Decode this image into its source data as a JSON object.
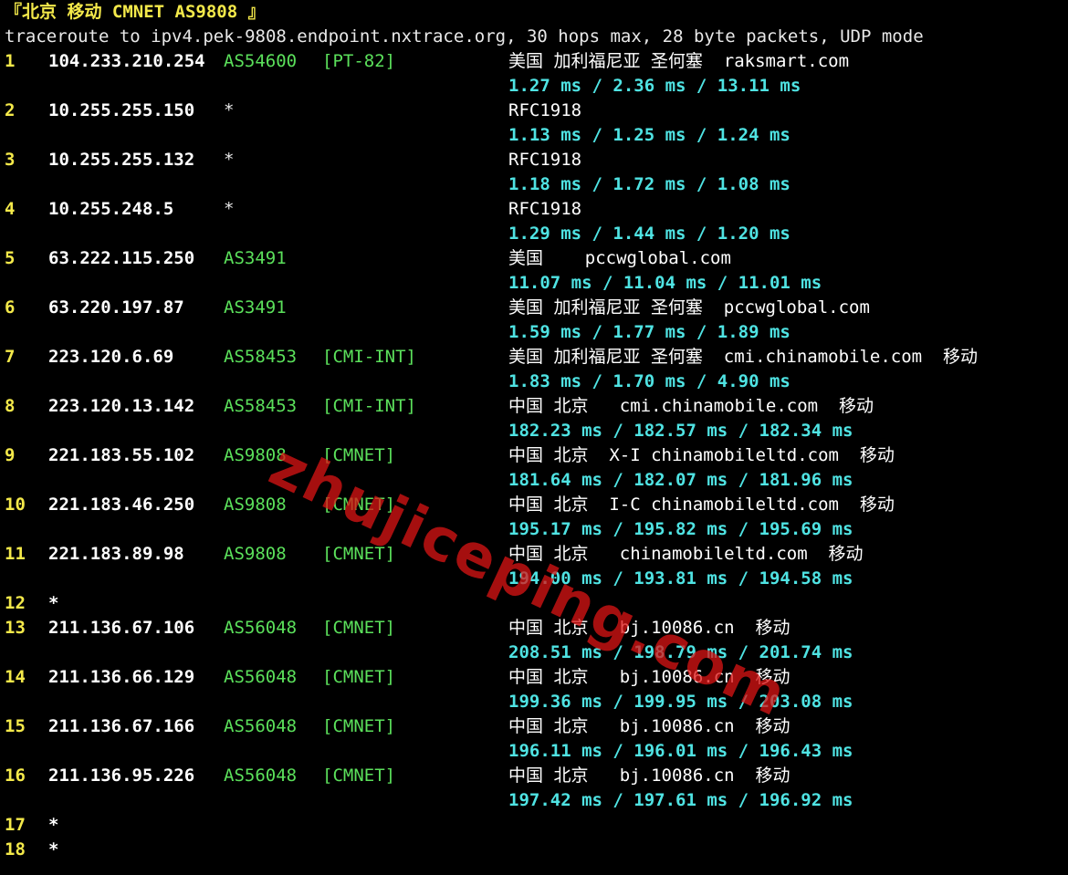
{
  "header": "『北京 移动 CMNET AS9808 』",
  "command": "traceroute to ipv4.pek-9808.endpoint.nxtrace.org, 30 hops max, 28 byte packets, UDP mode",
  "watermark": "zhujiceping.com",
  "hops": [
    {
      "hop": "1",
      "ip": "104.233.210.254",
      "asn": "AS54600",
      "tag": "[PT-82]",
      "geo": "美国 加利福尼亚 圣何塞  raksmart.com",
      "rtt": "1.27 ms / 2.36 ms / 13.11 ms"
    },
    {
      "hop": "2",
      "ip": "10.255.255.150",
      "asn": "*",
      "tag": "",
      "geo": "RFC1918",
      "rtt": "1.13 ms / 1.25 ms / 1.24 ms"
    },
    {
      "hop": "3",
      "ip": "10.255.255.132",
      "asn": "*",
      "tag": "",
      "geo": "RFC1918",
      "rtt": "1.18 ms / 1.72 ms / 1.08 ms"
    },
    {
      "hop": "4",
      "ip": "10.255.248.5",
      "asn": "*",
      "tag": "",
      "geo": "RFC1918",
      "rtt": "1.29 ms / 1.44 ms / 1.20 ms"
    },
    {
      "hop": "5",
      "ip": "63.222.115.250",
      "asn": "AS3491",
      "tag": "",
      "geo": "美国    pccwglobal.com",
      "rtt": "11.07 ms / 11.04 ms / 11.01 ms"
    },
    {
      "hop": "6",
      "ip": "63.220.197.87",
      "asn": "AS3491",
      "tag": "",
      "geo": "美国 加利福尼亚 圣何塞  pccwglobal.com",
      "rtt": "1.59 ms / 1.77 ms / 1.89 ms"
    },
    {
      "hop": "7",
      "ip": "223.120.6.69",
      "asn": "AS58453",
      "tag": "[CMI-INT]",
      "geo": "美国 加利福尼亚 圣何塞  cmi.chinamobile.com  移动",
      "rtt": "1.83 ms / 1.70 ms / 4.90 ms"
    },
    {
      "hop": "8",
      "ip": "223.120.13.142",
      "asn": "AS58453",
      "tag": "[CMI-INT]",
      "geo": "中国 北京   cmi.chinamobile.com  移动",
      "rtt": "182.23 ms / 182.57 ms / 182.34 ms"
    },
    {
      "hop": "9",
      "ip": "221.183.55.102",
      "asn": "AS9808",
      "tag": "[CMNET]",
      "geo": "中国 北京  X-I chinamobileltd.com  移动",
      "rtt": "181.64 ms / 182.07 ms / 181.96 ms"
    },
    {
      "hop": "10",
      "ip": "221.183.46.250",
      "asn": "AS9808",
      "tag": "[CMNET]",
      "geo": "中国 北京  I-C chinamobileltd.com  移动",
      "rtt": "195.17 ms / 195.82 ms / 195.69 ms"
    },
    {
      "hop": "11",
      "ip": "221.183.89.98",
      "asn": "AS9808",
      "tag": "[CMNET]",
      "geo": "中国 北京   chinamobileltd.com  移动",
      "rtt": "194.00 ms / 193.81 ms / 194.58 ms"
    },
    {
      "hop": "12",
      "ip": "*",
      "asn": "",
      "tag": "",
      "geo": "",
      "rtt": ""
    },
    {
      "hop": "13",
      "ip": "211.136.67.106",
      "asn": "AS56048",
      "tag": "[CMNET]",
      "geo": "中国 北京   bj.10086.cn  移动",
      "rtt": "208.51 ms / 198.79 ms / 201.74 ms"
    },
    {
      "hop": "14",
      "ip": "211.136.66.129",
      "asn": "AS56048",
      "tag": "[CMNET]",
      "geo": "中国 北京   bj.10086.cn  移动",
      "rtt": "199.36 ms / 199.95 ms / 203.08 ms"
    },
    {
      "hop": "15",
      "ip": "211.136.67.166",
      "asn": "AS56048",
      "tag": "[CMNET]",
      "geo": "中国 北京   bj.10086.cn  移动",
      "rtt": "196.11 ms / 196.01 ms / 196.43 ms"
    },
    {
      "hop": "16",
      "ip": "211.136.95.226",
      "asn": "AS56048",
      "tag": "[CMNET]",
      "geo": "中国 北京   bj.10086.cn  移动",
      "rtt": "197.42 ms / 197.61 ms / 196.92 ms"
    },
    {
      "hop": "17",
      "ip": "*",
      "asn": "",
      "tag": "",
      "geo": "",
      "rtt": ""
    },
    {
      "hop": "18",
      "ip": "*",
      "asn": "",
      "tag": "",
      "geo": "",
      "rtt": ""
    }
  ]
}
